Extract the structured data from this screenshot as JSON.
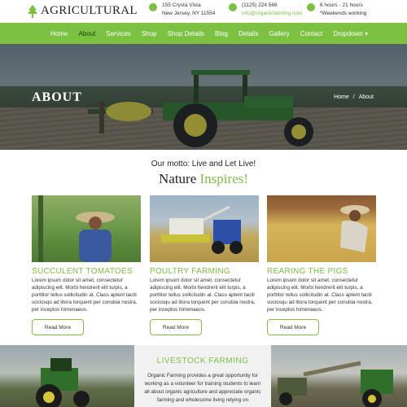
{
  "brand": {
    "name": "Agricultural",
    "accent": "#7cc142"
  },
  "header": {
    "address": {
      "line1": "155 Crysta Vista",
      "line2": "New Jersey, NY 11554",
      "icon": "map-pin-icon"
    },
    "phone": {
      "line1": "(1125) 224 566",
      "line2": "info@organicfarming.com",
      "icon": "phone-icon"
    },
    "hours": {
      "line1": "6 hours - 21 hours",
      "line2": "*Weekends working",
      "icon": "clock-icon"
    }
  },
  "nav": {
    "items": [
      "Home",
      "About",
      "Services",
      "Shop",
      "Shop Details",
      "Blog",
      "Details",
      "Gallery",
      "Contact",
      "Dropdown ▾"
    ],
    "active": "About"
  },
  "hero": {
    "title": "ABOUT",
    "breadcrumb": [
      "Home",
      "About"
    ]
  },
  "intro": {
    "motto": "Our motto: Live and Let Live!",
    "tagline_a": "Nature ",
    "tagline_b": "Inspires!"
  },
  "cards": [
    {
      "title": "SUCCULENT TOMATOES",
      "text": "Lorem ipsum dolor sit amet, consectetur adipiscing elit. Morbi hendrerit elit turpis, a porttitor tellus sollicitudin at. Class aptent taciti sociosqu ad litora torquent per conubia nostra, per inceptos himenaeos.",
      "button": "Read More"
    },
    {
      "title": "POULTRY FARMING",
      "text": "Lorem ipsum dolor sit amet, consectetur adipiscing elit. Morbi hendrerit elit turpis, a porttitor tellus sollicitudin at. Class aptent taciti sociosqu ad litora torquent per conubia nostra, per inceptos himenaeos.",
      "button": "Read More"
    },
    {
      "title": "REARING THE PIGS",
      "text": "Lorem ipsum dolor sit amet, consectetur adipiscing elit. Morbi hendrerit elit turpis, a porttitor tellus sollicitudin at. Class aptent taciti sociosqu ad litora torquent per conubia nostra, per inceptos himenaeos.",
      "button": "Read More"
    }
  ],
  "livestock": {
    "title": "LIVESTOCK FARMING",
    "text": "Organic Farming provides a great opportunity for working as a volunteer for training students to learn all about organic agriculture and appreciate organic farming and wholesome living relying on"
  }
}
